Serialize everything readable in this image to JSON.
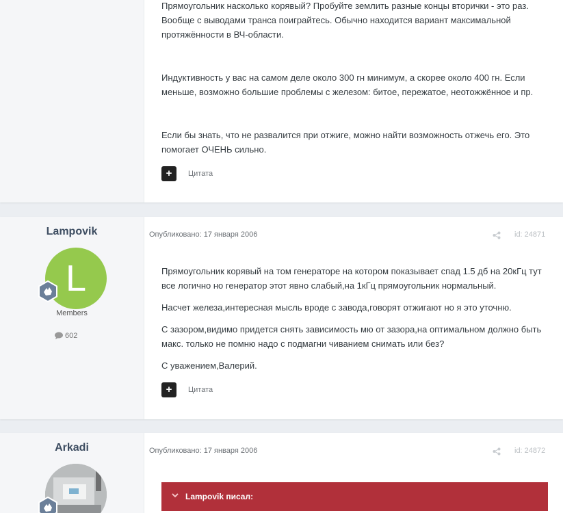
{
  "post1": {
    "paragraphs": [
      "Прямоугольник насколько корявый? Пробуйте землить разные концы вторички - это раз. Вообще с выводами транса поиграйтесь. Обычно находится вариант максимальной протяжённости в ВЧ-области.",
      "Индуктивность у вас на самом деле около 300 гн минимум, а скорее около 400 гн. Если меньше, возможно большие проблемы с железом: битое, пережатое, неотожжённое и пр.",
      "Если бы знать, что не развалится при отжиге, можно найти возможность отжечь его. Это помогает ОЧЕНЬ сильно."
    ],
    "plus_label": "+",
    "quote_label": "Цитата"
  },
  "post2": {
    "author": "Lampovik",
    "avatar_letter": "L",
    "avatar_color": "#95c94d",
    "group": "Members",
    "post_count": "602",
    "published": "Опубликовано: 17 января 2006",
    "post_id": "id: 24871",
    "paragraphs": [
      "Прямоугольник корявый на том генераторе на котором показывает спад 1.5 дб на 20кГц тут все логично но генератор этот явно слабый,на 1кГц прямоугольник нормальный.",
      "Насчет железа,интересная мысль вроде с завода,говорят отжигают но я это уточню.",
      "С зазором,видимо придется снять зависимость мю от зазора,на оптимальном должно быть макс. только не помню надо с подмагни чиванием снимать или без?",
      "С уважением,Валерий."
    ],
    "plus_label": "+",
    "quote_label": "Цитата"
  },
  "post3": {
    "author": "Arkadi",
    "published": "Опубликовано: 17 января 2006",
    "post_id": "id: 24872",
    "quote_header": "Lampovik писал:",
    "quote_color": "#b1303a"
  }
}
